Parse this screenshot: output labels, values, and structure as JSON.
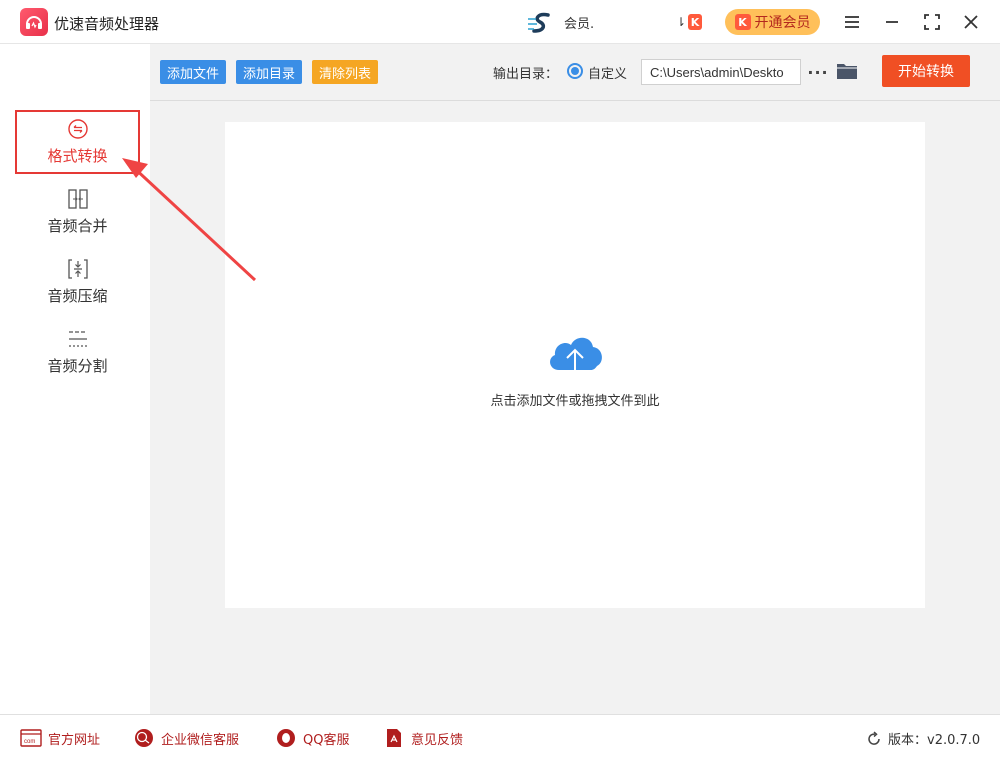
{
  "app": {
    "title": "优速音频处理器",
    "user_name": "会员.",
    "vip_label": "开通会员",
    "badge_letter": "K"
  },
  "sidebar": {
    "items": [
      {
        "label": "格式转换",
        "icon": "format-convert-icon"
      },
      {
        "label": "音频合并",
        "icon": "audio-merge-icon"
      },
      {
        "label": "音频压缩",
        "icon": "audio-compress-icon"
      },
      {
        "label": "音频分割",
        "icon": "audio-split-icon"
      }
    ]
  },
  "toolbar": {
    "add_file": "添加文件",
    "add_dir": "添加目录",
    "clear_list": "清除列表",
    "output_label": "输出目录：",
    "radio_label": "自定义",
    "path_value": "C:\\Users\\admin\\Deskto",
    "more": "···",
    "start": "开始转换"
  },
  "dropzone": {
    "hint": "点击添加文件或拖拽文件到此"
  },
  "footer": {
    "links": [
      "官方网址",
      "企业微信客服",
      "QQ客服",
      "意见反馈"
    ],
    "version": "版本：v2.0.7.0"
  },
  "colors": {
    "primary": "#3a8ee6",
    "danger": "#f04f24",
    "warning": "#f5a623",
    "accent_red": "#e53935"
  }
}
